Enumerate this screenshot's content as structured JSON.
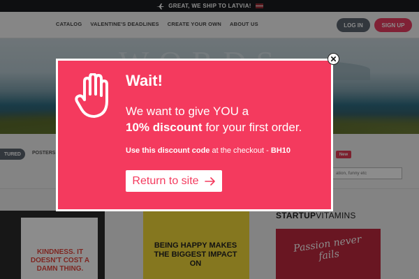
{
  "shipbar": {
    "text": "GREAT, WE SHIP TO LATVIA!",
    "icon": "airplane-icon",
    "flag": "latvia-flag-icon"
  },
  "nav": {
    "links": [
      "CATALOG",
      "VALENTINE'S DEADLINES",
      "CREATE YOUR OWN",
      "ABOUT US"
    ],
    "login": "LOG IN",
    "signup": "SIGN UP"
  },
  "hero": {
    "text": "WORDS"
  },
  "filters": {
    "active": "TURED",
    "chip": "POSTERS",
    "badge": "New",
    "search_placeholder": "ation, funny etc"
  },
  "products": {
    "poster1": "KINDNESS. IT DOESN'T COST A DAMN THING.",
    "poster2": "BEING HAPPY MAKES THE BIGGEST IMPACT ON",
    "brand_bold": "STARTUP",
    "brand_light": "VITAMINS",
    "poster3": "Passion never fails"
  },
  "modal": {
    "title": "Wait!",
    "line1": "We want to give YOU a",
    "discount": "10% discount",
    "line2_rest": "for your first order.",
    "code_lead": "Use this discount code",
    "code_mid": "at the checkout -",
    "code": "BH10",
    "button": "Return to site"
  },
  "colors": {
    "accent": "#f43a5e",
    "dark": "#1b1d20",
    "login": "#5b6470",
    "signup": "#ea3c62"
  }
}
